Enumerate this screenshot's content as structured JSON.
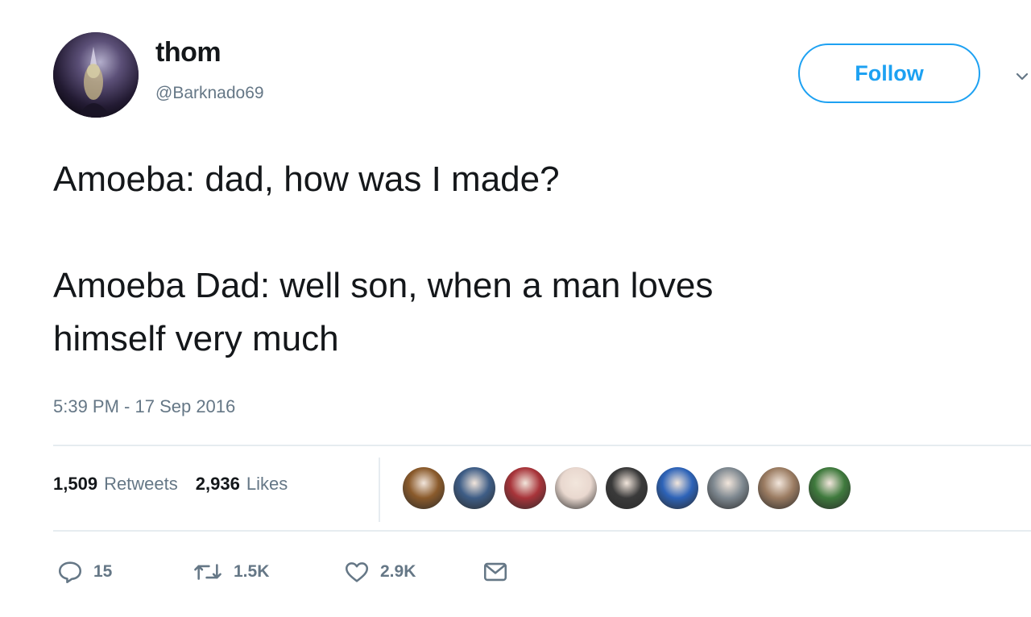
{
  "user": {
    "name": "thom",
    "handle": "@Barknado69"
  },
  "follow_label": "Follow",
  "tweet": {
    "lines_block_1": [
      "Amoeba: dad, how was I made?"
    ],
    "lines_block_2": [
      "Amoeba Dad: well son, when a man loves",
      "himself very much"
    ]
  },
  "timestamp": "5:39 PM - 17 Sep 2016",
  "stats": {
    "retweets_count": "1,509",
    "retweets_label": "Retweets",
    "likes_count": "2,936",
    "likes_label": "Likes"
  },
  "liker_avatar_colors": [
    "#8a5a2b",
    "#3e5d86",
    "#a8343a",
    "#e9d8cf",
    "#3a3a3a",
    "#2d63b8",
    "#7e8890",
    "#9b7c62",
    "#3f7a3d"
  ],
  "actions": {
    "reply_count": "15",
    "retweet_count": "1.5K",
    "like_count": "2.9K"
  },
  "colors": {
    "accent": "#1da1f2",
    "secondary_text": "#657786",
    "divider": "#e6ecf0"
  },
  "icons": [
    "reply-icon",
    "retweet-icon",
    "like-icon",
    "dm-icon",
    "chevron-down-icon"
  ]
}
